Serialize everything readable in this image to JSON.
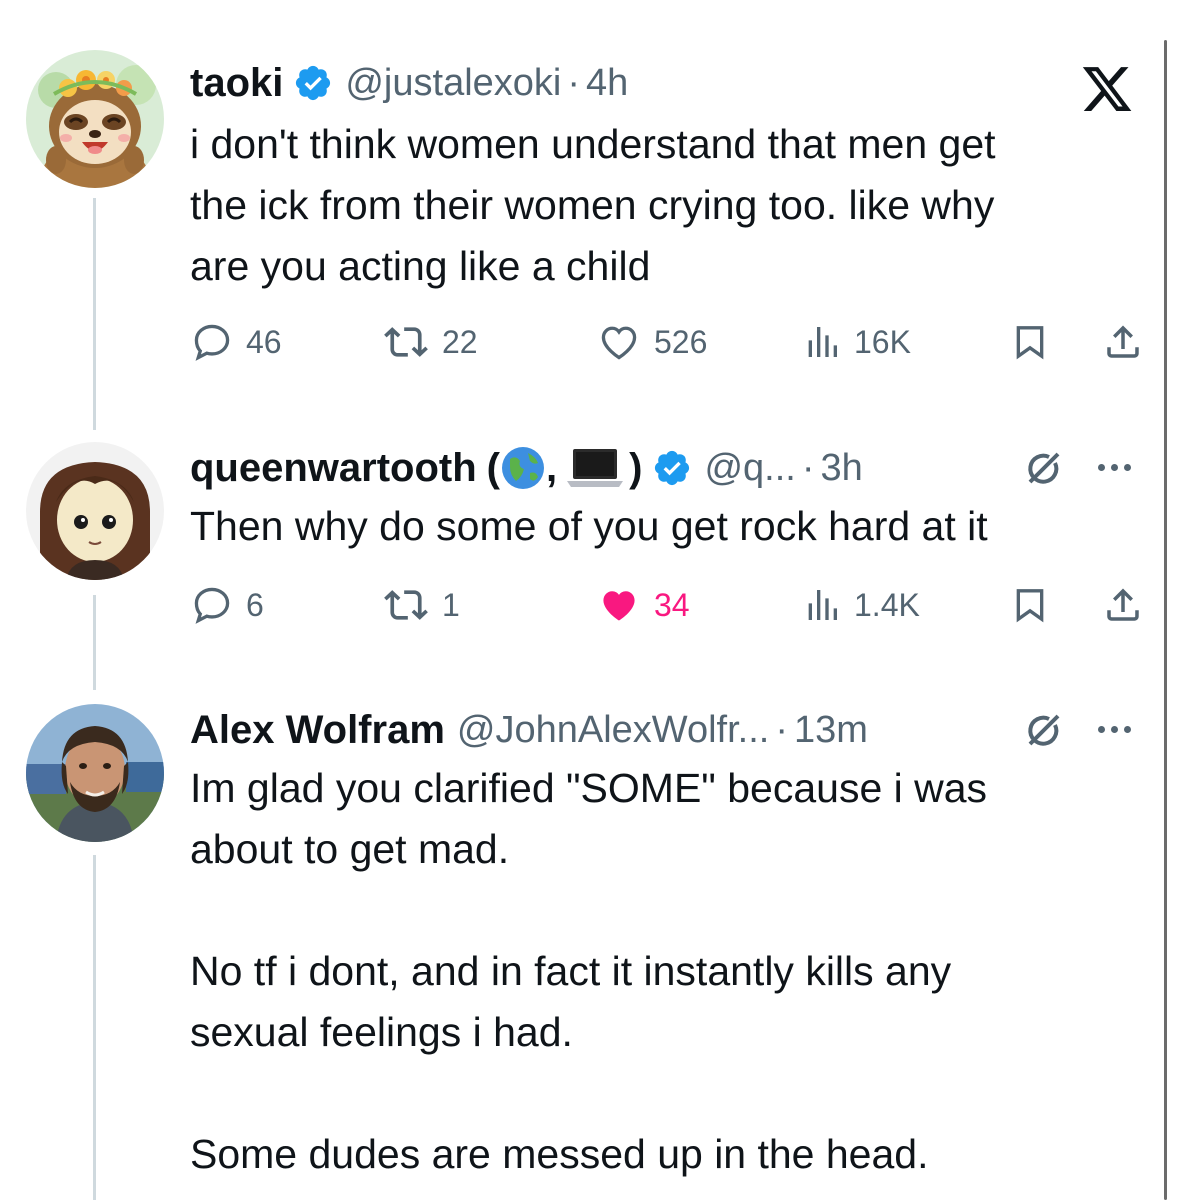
{
  "colors": {
    "text": "#0f1419",
    "secondary": "#536471",
    "verified": "#1d9bf0",
    "like": "#f91880",
    "thread_line": "#cfd9de"
  },
  "tweets": [
    {
      "name": "taoki",
      "handle": "@justalexoki",
      "sep": "·",
      "time": "4h",
      "verified": true,
      "text": "i don't think women understand that men get\nthe ick from their women crying too. like why\nare you acting like a child",
      "replies": "46",
      "retweets": "22",
      "likes": "526",
      "views": "16K",
      "liked": false,
      "top_right_icon": "x-logo-icon"
    },
    {
      "name": "queenwartooth",
      "name_suffix_open": "(",
      "name_suffix_comma": ",",
      "name_suffix_close": ")",
      "name_emojis": [
        "globe-emoji",
        "laptop-emoji"
      ],
      "handle": "@q...",
      "sep": "·",
      "time": "3h",
      "verified": true,
      "text": "Then why do some of you get rock hard at it",
      "replies": "6",
      "retweets": "1",
      "likes": "34",
      "views": "1.4K",
      "liked": true,
      "top_right_icon": "grok-icon"
    },
    {
      "name": "Alex Wolfram",
      "handle": "@JohnAlexWolfr...",
      "sep": "·",
      "time": "13m",
      "verified": false,
      "text": "Im glad you clarified \"SOME\" because i was\nabout to get mad.\n\nNo tf i dont, and in fact it instantly kills any\nsexual feelings i had.\n\nSome dudes are messed up in the head.",
      "top_right_icon": "grok-icon"
    }
  ]
}
